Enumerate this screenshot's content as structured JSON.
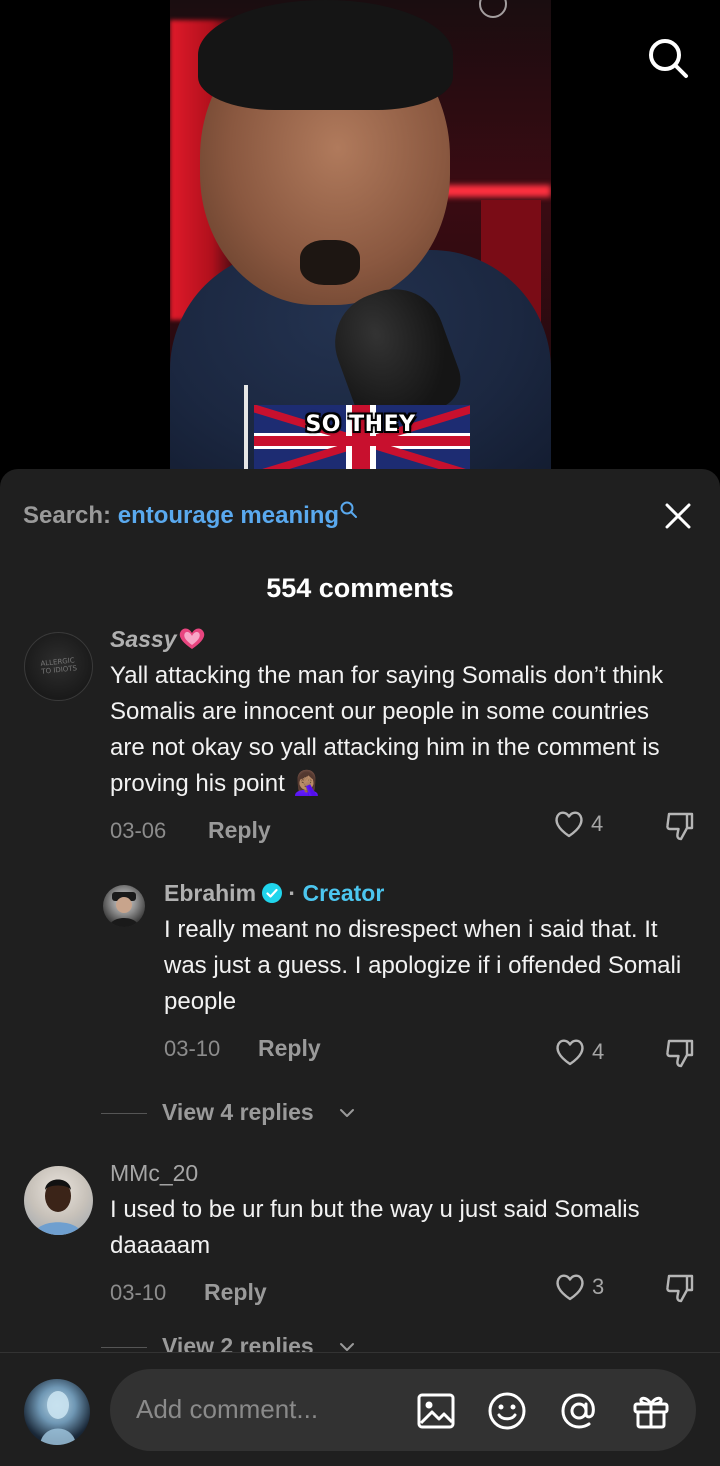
{
  "video": {
    "caption": "SO THEY"
  },
  "sheet": {
    "search_prefix": "Search:",
    "search_term": "entourage meaning",
    "comment_count": "554 comments"
  },
  "comments": [
    {
      "username": "Sassy",
      "body": "Yall attacking the man for saying Somalis don’t think Somalis are innocent our people in some countries are not okay so yall attacking him in the comment is proving his point 🤦🏽‍♀️",
      "date": "03-06",
      "reply_label": "Reply",
      "likes": "4"
    },
    {
      "username": "Ebrahim",
      "creator_label": "Creator",
      "separator": "·",
      "body": "I really meant no disrespect when i said that. It was just a guess. I apologize if i offended Somali people",
      "date": "03-10",
      "reply_label": "Reply",
      "likes": "4"
    },
    {
      "username": "MMc_20",
      "body": "I used to be ur fun but the way u just said Somalis daaaaam",
      "date": "03-10",
      "reply_label": "Reply",
      "likes": "3"
    }
  ],
  "view_replies_1": "View 4 replies",
  "view_replies_2": "View 2 replies",
  "composer": {
    "placeholder": "Add comment..."
  },
  "colors": {
    "sheet_bg": "#1f1f1f",
    "search_term": "#5aa9ee",
    "creator_tag": "#4cc6ef"
  }
}
